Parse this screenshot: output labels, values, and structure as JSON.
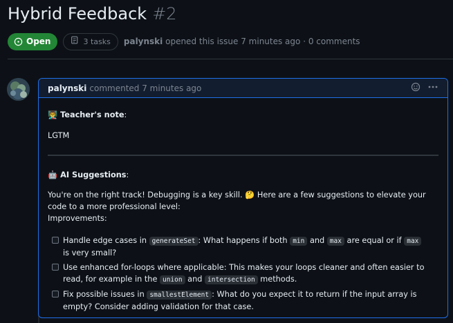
{
  "issue": {
    "title": "Hybrid Feedback",
    "number": "#2",
    "state": "Open",
    "tasks": "3 tasks",
    "author": "palynski",
    "opened_text": "opened this issue 7 minutes ago · 0 comments"
  },
  "comment": {
    "author": "palynski",
    "meta": "commented 7 minutes ago",
    "teacher_heading": "Teacher's note",
    "teacher_emoji": "👨‍🏫",
    "teacher_note": "LGTM",
    "ai_heading": "AI Suggestions",
    "ai_emoji": "🤖",
    "intro": "You're on the right track! Debugging is a key skill. 🤔 Here are a few suggestions to elevate your code to a more professional level:",
    "improvements_label": "Improvements:",
    "tasks": [
      {
        "p1": "Handle edge cases in ",
        "c1": "generateSet",
        "p2": ": What happens if both ",
        "c2": "min",
        "p3": " and ",
        "c3": "max",
        "p4": " are equal or if ",
        "c4": "max",
        "p5": " is very small?"
      },
      {
        "p1": "Use enhanced for-loops where applicable: This makes your loops cleaner and often easier to read, for example in the ",
        "c1": "union",
        "p2": " and ",
        "c2": "intersection",
        "p3": " methods."
      },
      {
        "p1": "Fix possible issues in ",
        "c1": "smallestElement",
        "p2": ": What do you expect it to return if the input array is empty? Consider adding validation for that case."
      }
    ]
  },
  "colors": {
    "background": "#0d1117",
    "open_badge": "#238636",
    "comment_border": "#1f6feb",
    "comment_header": "#121d2f"
  },
  "icons": [
    "issue-open-icon",
    "tasklist-icon",
    "emoji-icon",
    "kebab-icon"
  ]
}
